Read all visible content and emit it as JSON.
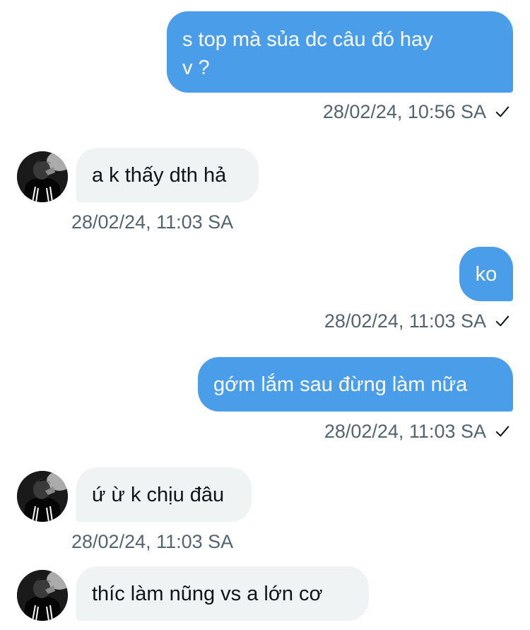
{
  "messages": [
    {
      "id": "m1",
      "direction": "out",
      "text": "s top mà sủa dc câu đó hay\nv ?",
      "timestamp": "28/02/24, 10:56 SA",
      "status": "sent"
    },
    {
      "id": "m2",
      "direction": "in",
      "text": "a k thấy dth hả",
      "timestamp": "28/02/24, 11:03 SA"
    },
    {
      "id": "m3",
      "direction": "out",
      "text": "ko",
      "timestamp": "28/02/24, 11:03 SA",
      "status": "sent"
    },
    {
      "id": "m4",
      "direction": "out",
      "text": "gớm lắm sau đừng làm nữa",
      "timestamp": "28/02/24, 11:03 SA",
      "status": "sent"
    },
    {
      "id": "m5",
      "direction": "in",
      "text": "ứ ừ k chịu đâu",
      "timestamp": "28/02/24, 11:03 SA"
    },
    {
      "id": "m6",
      "direction": "in",
      "text": "thíc làm nũng vs a lớn cơ"
    }
  ],
  "colors": {
    "outgoing_bubble": "#4a9ee9",
    "incoming_bubble": "#eff3f4",
    "timestamp_text": "#536471"
  },
  "icons": {
    "sent_status": "checkmark-icon",
    "avatar": "user-avatar"
  }
}
